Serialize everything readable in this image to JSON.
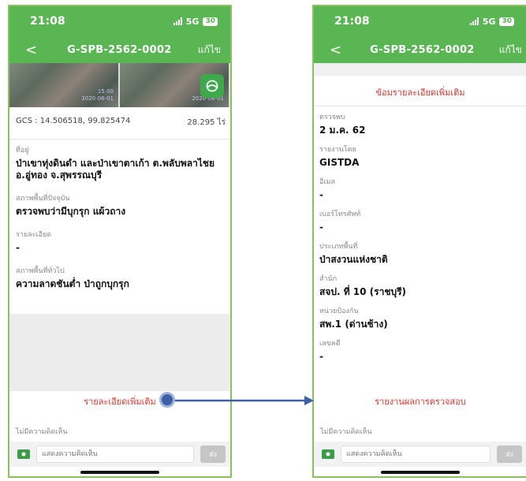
{
  "status": {
    "time": "21:08",
    "network": "5G",
    "battery": "30"
  },
  "nav": {
    "back": "<",
    "title": "G-SPB-2562-0002",
    "edit": "แก้ไข"
  },
  "images": {
    "tile_label": "15:00\n2020-06-01"
  },
  "location": {
    "gcs": "GCS : 14.506518, 99.825474",
    "area": "28.295 ไร่"
  },
  "left_fields": [
    {
      "label": "ที่อยู่",
      "value": "ป่าเขาทุ่งดินดำ และป่าเขาตาเก้า ต.พลับพลาไชย อ.อู่ทอง จ.สุพรรณบุรี"
    },
    {
      "label": "สภาพพื้นที่ปัจจุบัน",
      "value": "ตรวจพบว่ามีบุกรุก แผ้วถาง"
    },
    {
      "label": "รายละเอียด",
      "value": "-"
    },
    {
      "label": "สภาพพื้นที่ทั่วไป",
      "value": "ความลาดชันต่ำ ป่าถูกบุกรุก"
    }
  ],
  "more_details": "รายละเอียดเพิ่มเติม",
  "no_comment": "ไม่มีความคิดเห็น",
  "comment": {
    "placeholder": "แสดงความคิดเห็น",
    "send": "ส่ง"
  },
  "right": {
    "heading": "ข้อมรายละเอียดเพิ่มเติม",
    "fields": [
      {
        "label": "ตรวจพบ",
        "value": "2 ม.ค. 62"
      },
      {
        "label": "รายงานโดย",
        "value": "GISTDA"
      },
      {
        "label": "อีเมล",
        "value": "-"
      },
      {
        "label": "เบอร์โทรศัพท์",
        "value": "-"
      },
      {
        "label": "ประเภทพื้นที่",
        "value": "ป่าสงวนแห่งชาติ"
      },
      {
        "label": "สำนัก",
        "value": "สจป. ที่ 10 (ราชบุรี)"
      },
      {
        "label": "หน่วยป้องกัน",
        "value": "สพ.1 (ด่านช้าง)"
      },
      {
        "label": "เลขคดี",
        "value": "-"
      }
    ],
    "report_link": "รายงานผลการตรวจสอบ"
  },
  "colors": {
    "brand_green": "#59b653",
    "link_red": "#d9342b",
    "arrow_blue": "#3e5fa6"
  },
  "icons": [
    "signal-icon",
    "battery-icon",
    "back-icon",
    "map-layers-icon",
    "camera-icon",
    "pointer-dot-icon",
    "arrow-icon"
  ]
}
